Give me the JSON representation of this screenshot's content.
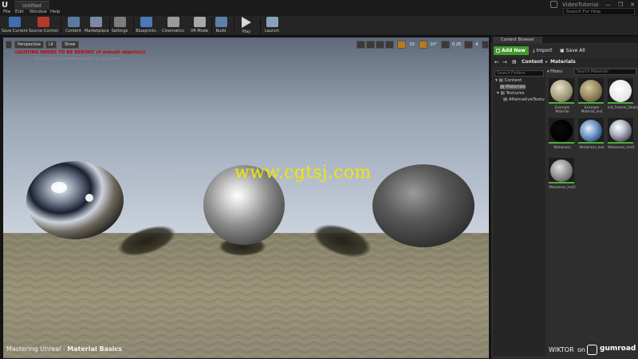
{
  "window": {
    "tab_title": "Untitled",
    "project_name": "VideoTutorial",
    "controls": [
      "—",
      "❐",
      "✕"
    ]
  },
  "menu": [
    {
      "label": "File"
    },
    {
      "label": "Edit"
    },
    {
      "label": "Window"
    },
    {
      "label": "Help"
    }
  ],
  "search_help": {
    "placeholder": "Search For Help"
  },
  "toolbar": [
    {
      "label": "Save Current",
      "icon": "save-icon",
      "color": "#3f6fb0"
    },
    {
      "label": "Source Control",
      "icon": "source-control-icon",
      "color": "#b33a2c"
    },
    {
      "label": "Content",
      "icon": "content-icon",
      "color": "#5b7a9e"
    },
    {
      "label": "Marketplace",
      "icon": "marketplace-icon",
      "color": "#7a8aa0"
    },
    {
      "label": "Settings",
      "icon": "settings-icon",
      "color": "#7c7c7c"
    },
    {
      "label": "Blueprints",
      "icon": "blueprints-icon",
      "color": "#4a78b8"
    },
    {
      "label": "Cinematics",
      "icon": "cinematics-icon",
      "color": "#9a9a9a"
    },
    {
      "label": "VR Mode",
      "icon": "vr-mode-icon",
      "color": "#a8a8a8"
    },
    {
      "label": "Build",
      "icon": "build-icon",
      "color": "#5e7fa8"
    },
    {
      "label": "Play",
      "icon": "play-icon",
      "color": "#cfcfcf"
    },
    {
      "label": "Launch",
      "icon": "launch-icon",
      "color": "#8aa0b8"
    }
  ],
  "viewport": {
    "perspective": "Perspective",
    "lit": "Lit",
    "show": "Show",
    "warning": "LIGHTING NEEDS TO BE REBUILT (4 unbuilt object(s))",
    "suppress": "'DisableAllScreenMessages' to suppress",
    "snap_grid": "10",
    "snap_rot": "10°",
    "snap_scale": "0.25",
    "cam_speed": "4",
    "watermark": "www.cgtsj.com",
    "course_prefix": "Mastering Unreal - ",
    "course_title": "Material Basics"
  },
  "content_browser": {
    "tab": "Content Browser",
    "add_new": "Add New",
    "import": "Import",
    "save_all": "Save All",
    "breadcrumb": [
      "Content",
      "Materials"
    ],
    "search_folders": "Search Folders",
    "filters": "Filters",
    "search_materials": "Search Materials",
    "tree": [
      {
        "label": "Content",
        "selected": false
      },
      {
        "label": "Materials",
        "selected": true
      },
      {
        "label": "Textures",
        "selected": false
      },
      {
        "label": "AlternativeTextu",
        "selected": false
      }
    ],
    "assets": [
      {
        "name": "Example Material",
        "style": "stone"
      },
      {
        "name": "Example Material_Inst",
        "style": "rock"
      },
      {
        "name": "Init_Fresnel_Deaturation",
        "style": "white"
      },
      {
        "name": "Metalness",
        "style": "black"
      },
      {
        "name": "Metalness_Inst",
        "style": "earth"
      },
      {
        "name": "Metalness_Inst1",
        "style": "chrome"
      },
      {
        "name": "Metalness_Inst2",
        "style": "grey"
      }
    ]
  },
  "branding": {
    "author": "WIKTOR",
    "on": "on",
    "brand": "gumroad"
  }
}
